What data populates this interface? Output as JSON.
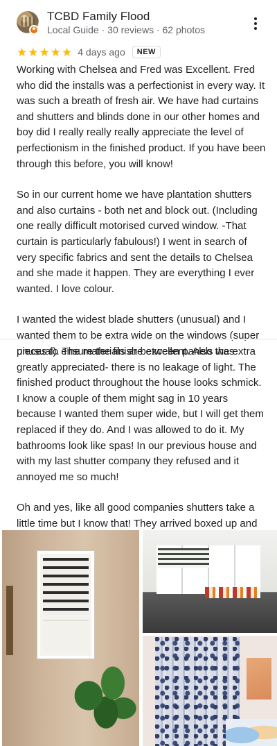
{
  "reviewer": {
    "name": "TCBD Family Flood",
    "meta": "Local Guide · 30 reviews · 62 photos",
    "avatar_icon": "profile-photo-icon",
    "badge_icon": "local-guide-badge-icon"
  },
  "menu": {
    "icon": "more-vert-icon"
  },
  "rating": {
    "stars": 5,
    "star_color": "#fbbc04",
    "time": "4 days ago",
    "badge": "NEW"
  },
  "review": {
    "paragraphs": [
      "Working with Chelsea and Fred was Excellent. Fred who did the installs was a perfectionist in every way. It was such a breath of fresh air. We have had curtains and shutters and blinds done in our other homes and boy did I really really really appreciate the level of perfectionism in the finished product. If you have been through this before, you will know!",
      "So in our current home we have plantation shutters and also curtains - both net and block out. (Including one really difficult motorised curved window. -That curtain is particularly fabulous!) I went in search of very specific fabrics and sent the details to Chelsea and she made it happen. They are everything I ever wanted. I love colour.",
      "I wanted the widest blade shutters (unusual) and I wanted them to be extra wide on the windows (super unusual). The materials are excellent. Also the extra"
    ],
    "continuation": [
      "pieces to ensure the finish between panels was greatly appreciated- there is no leakage of light. The finished product throughout the house looks schmick. I know a couple of them might sag in 10 years because I wanted them super wide, but I will get them replaced if they do. And I was allowed to do it. My bathrooms look like spas! In our previous house and with my last shutter company they refused and it annoyed me so much!",
      "Oh and yes, like all good companies shutters take a little time but I know that! They arrived boxed up and ready and perfect."
    ]
  },
  "photos": [
    {
      "name": "photo-plantation-shutter-window"
    },
    {
      "name": "photo-shutters-dining-room"
    },
    {
      "name": "photo-patterned-curtains"
    }
  ]
}
